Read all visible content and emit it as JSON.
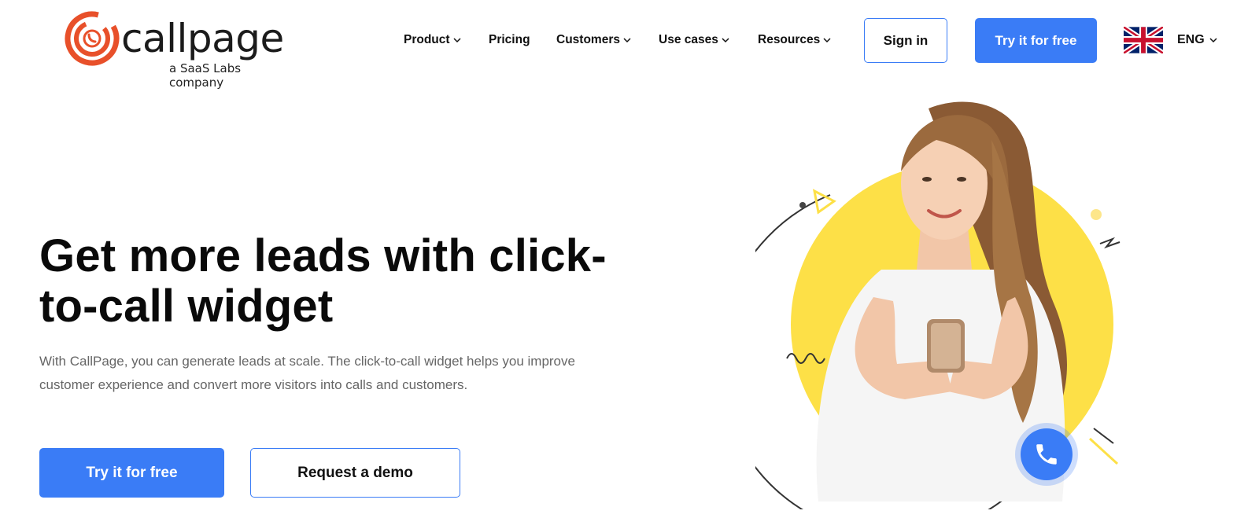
{
  "brand": {
    "name": "callpage",
    "tagline": "a SaaS Labs company",
    "accent": "#3a7cf6",
    "logo_color": "#e8502a"
  },
  "nav": {
    "items": [
      {
        "label": "Product",
        "has_dropdown": true
      },
      {
        "label": "Pricing",
        "has_dropdown": false
      },
      {
        "label": "Customers",
        "has_dropdown": true
      },
      {
        "label": "Use cases",
        "has_dropdown": true
      },
      {
        "label": "Resources",
        "has_dropdown": true
      }
    ],
    "sign_in": "Sign in",
    "try_free": "Try it for free",
    "language": "ENG",
    "language_icon": "uk-flag-icon"
  },
  "hero": {
    "title": "Get more leads with click-to-call widget",
    "description": "With CallPage, you can generate leads at scale. The click-to-call widget helps you improve customer experience and convert more visitors into calls and customers.",
    "primary_cta": "Try it for free",
    "secondary_cta": "Request a demo",
    "accent_yellow": "#fde047"
  }
}
